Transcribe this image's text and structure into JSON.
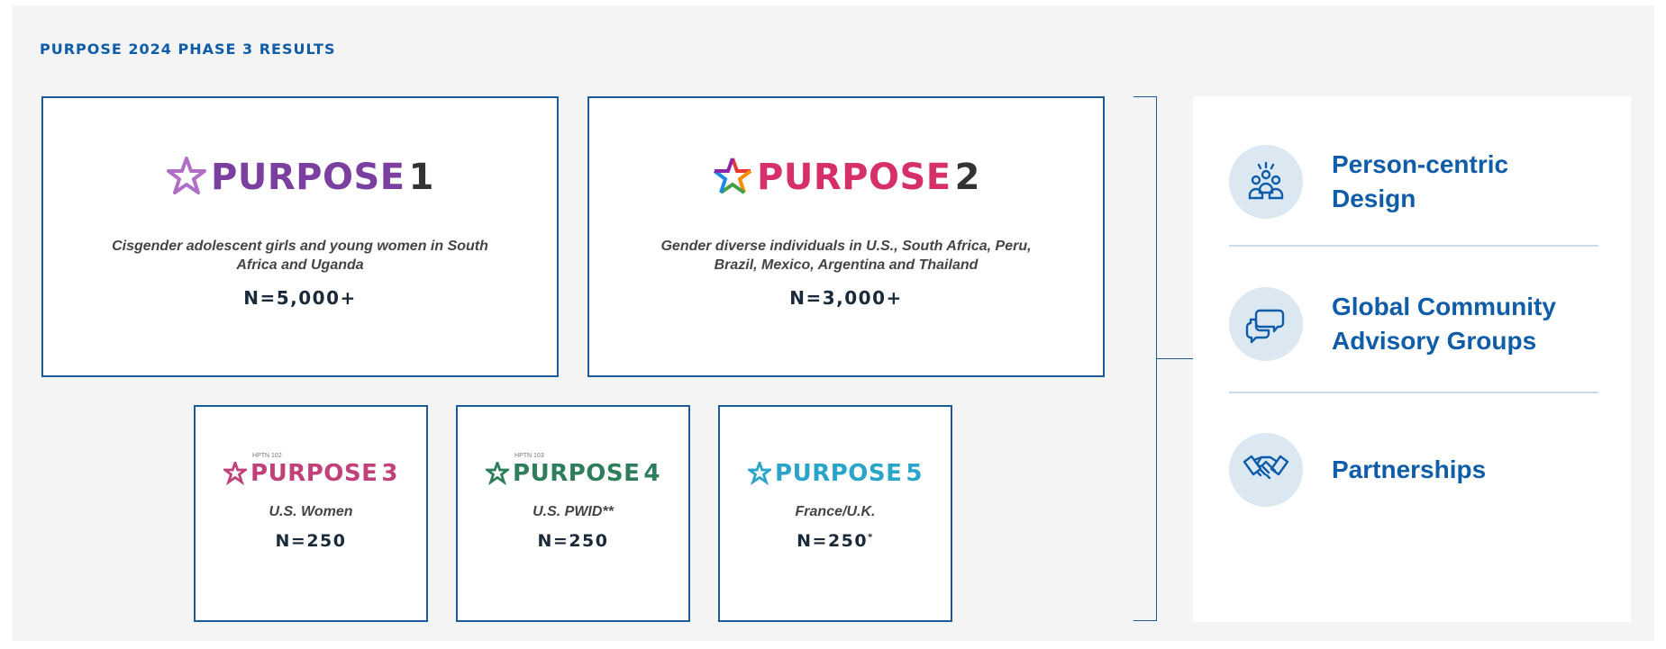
{
  "heading": "PURPOSE 2024 PHASE 3 RESULTS",
  "studies": [
    {
      "logo": "PURPOSE",
      "number": "1",
      "description": "Cisgender adolescent girls and young women in South Africa and Uganda",
      "count": "N=5,000+"
    },
    {
      "logo": "PURPOSE",
      "number": "2",
      "description": "Gender diverse individuals in U.S., South Africa, Peru, Brazil, Mexico, Argentina and Thailand",
      "count": "N=3,000+"
    },
    {
      "logo": "PURPOSE",
      "number": "3",
      "tag": "HPTN 102",
      "description": "U.S. Women",
      "count": "N=250"
    },
    {
      "logo": "PURPOSE",
      "number": "4",
      "tag": "HPTN 103",
      "description": "U.S. PWID**",
      "count": "N=250"
    },
    {
      "logo": "PURPOSE",
      "number": "5",
      "description": "France/U.K.",
      "count": "N=250",
      "count_mark": "*"
    }
  ],
  "features": [
    {
      "label": "Person-centric Design",
      "icon": "people-group-icon"
    },
    {
      "label": "Global Community Advisory Groups",
      "icon": "chat-bubbles-icon"
    },
    {
      "label": "Partnerships",
      "icon": "handshake-icon"
    }
  ],
  "colors": {
    "brand_blue": "#0f5ca8",
    "border_blue": "#1b5b9b",
    "purpose1": "#7b3fa0",
    "purpose3": "#c2407a",
    "purpose4": "#2e7d5b",
    "purpose5": "#2aa5c9"
  }
}
